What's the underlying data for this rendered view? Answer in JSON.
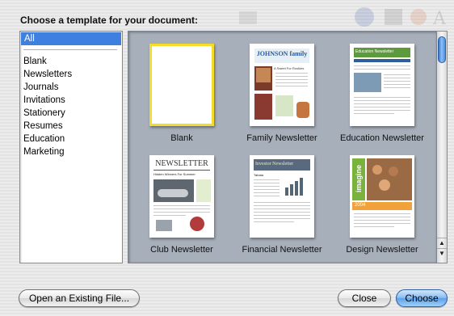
{
  "dialog": {
    "title": "Choose a template for your document:"
  },
  "categories": {
    "selected": "All",
    "items": [
      "Blank",
      "Newsletters",
      "Journals",
      "Invitations",
      "Stationery",
      "Resumes",
      "Education",
      "Marketing"
    ]
  },
  "templates": [
    {
      "label": "Blank"
    },
    {
      "label": "Family Newsletter",
      "masthead": "JOHNSON family",
      "subhead": "A Sweet For Rookies"
    },
    {
      "label": "Education Newsletter",
      "masthead": "Education Newsletter"
    },
    {
      "label": "Club Newsletter",
      "masthead": "NEWSLETTER",
      "subhead": "Hidden Winners For Summer"
    },
    {
      "label": "Financial Newsletter",
      "masthead": "Investor Newsletter",
      "subhead": "Tabata"
    },
    {
      "label": "Design Newsletter",
      "masthead": "imagine",
      "subhead": "2004"
    }
  ],
  "buttons": {
    "open": "Open an Existing File...",
    "close": "Close",
    "choose": "Choose"
  },
  "colors": {
    "selection": "#3d80df",
    "pane_bg": "#a7afba",
    "blank_border": "#f4dd2a",
    "default_button": "#5da2ea"
  }
}
